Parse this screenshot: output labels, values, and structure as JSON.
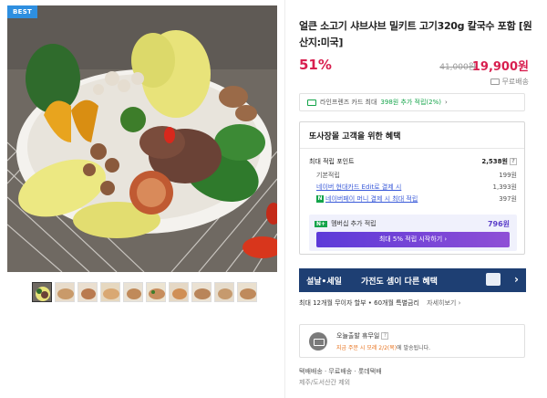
{
  "badge": "BEST",
  "product": {
    "title": "얼큰 소고기 샤브샤브 밀키트 고기320g 칼국수 포함 [원산지:미국]"
  },
  "price": {
    "discount": "51%",
    "original": "41,000원",
    "sale": "19,900원",
    "shipping": "무료배송"
  },
  "card_promo": {
    "prefix": "라인프렌즈 카드 최대",
    "highlight": "398원 추가 적립(2%)",
    "arrow": "›"
  },
  "benefit": {
    "title": "또사장몰 고객을 위한 혜택",
    "rows": [
      {
        "label": "최대 적립 포인트",
        "value": "2,538원"
      },
      {
        "label": "기본적립",
        "value": "199원"
      },
      {
        "label": "네이버 현대카드 Edit로 결제 시",
        "value": "1,393원"
      },
      {
        "label": "네이버페이 머니 결제 시 최대 적립",
        "value": "397원"
      }
    ],
    "member": {
      "badge": "N+",
      "label": "멤버십 추가 적립",
      "amount": "796원",
      "button": "최대 5% 적립 시작하기 ›"
    }
  },
  "banner": {
    "left": "설날•세일",
    "middle": "가전도 셈이 다른 혜택",
    "arrow": "›"
  },
  "installment": {
    "text": "최대 12개월 무이자 할부 • 60개월 특별금리",
    "more": "자세히보기 ›"
  },
  "shipping_box": {
    "title": "오늘출발 휴무일",
    "note_highlight": "지금 주문 시 모레 2/2(목)",
    "note_suffix": "에 발송됩니다."
  },
  "delivery_info": {
    "line1": "택배배송 · 무료배송 · 롯데택배",
    "line2": "제주/도서산간 제외"
  },
  "icons": [
    "truck-icon",
    "card-icon",
    "question-icon",
    "naverpay-icon",
    "delivery-icon",
    "chevron-right-icon"
  ],
  "colors": {
    "accent": "#d81f4f",
    "naver": "#14a44a",
    "banner": "#1e3f73",
    "member_btn": "#5c3ad8"
  }
}
